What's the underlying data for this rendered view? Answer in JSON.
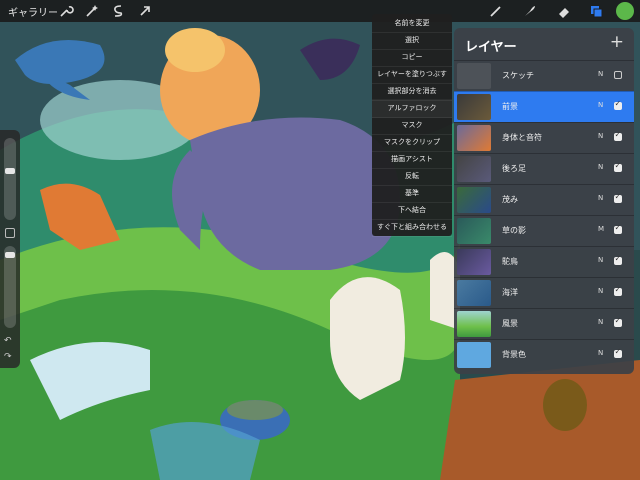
{
  "toolbar": {
    "gallery_label": "ギャラリー",
    "left_tools": [
      "wrench-icon",
      "magic-wand-icon",
      "selection-icon",
      "transform-arrow-icon"
    ],
    "right_tools": [
      "brush-icon",
      "smudge-icon",
      "eraser-icon",
      "layers-icon"
    ]
  },
  "context_menu": {
    "items": [
      "名前を変更",
      "選択",
      "コピー",
      "レイヤーを塗りつぶす",
      "選択部分を消去",
      "アルファロック",
      "マスク",
      "マスクをクリップ",
      "描画アシスト",
      "反転",
      "基準",
      "下へ結合",
      "すぐ下と組み合わせる"
    ]
  },
  "layers_panel": {
    "title": "レイヤー",
    "add_label": "+",
    "layers": [
      {
        "name": "スケッチ",
        "blend": "N",
        "visible": false,
        "selected": false
      },
      {
        "name": "前景",
        "blend": "N",
        "visible": true,
        "selected": true
      },
      {
        "name": "身体と音符",
        "blend": "N",
        "visible": true,
        "selected": false
      },
      {
        "name": "後ろ足",
        "blend": "N",
        "visible": true,
        "selected": false
      },
      {
        "name": "茂み",
        "blend": "N",
        "visible": true,
        "selected": false
      },
      {
        "name": "草の影",
        "blend": "M",
        "visible": true,
        "selected": false
      },
      {
        "name": "駝鳥",
        "blend": "N",
        "visible": true,
        "selected": false
      },
      {
        "name": "海洋",
        "blend": "N",
        "visible": true,
        "selected": false
      },
      {
        "name": "風景",
        "blend": "N",
        "visible": true,
        "selected": false
      },
      {
        "name": "背景色",
        "blend": "N",
        "visible": true,
        "selected": false
      }
    ]
  },
  "colors": {
    "accent": "#2e7bf0",
    "current_color": "#5cb84a"
  }
}
